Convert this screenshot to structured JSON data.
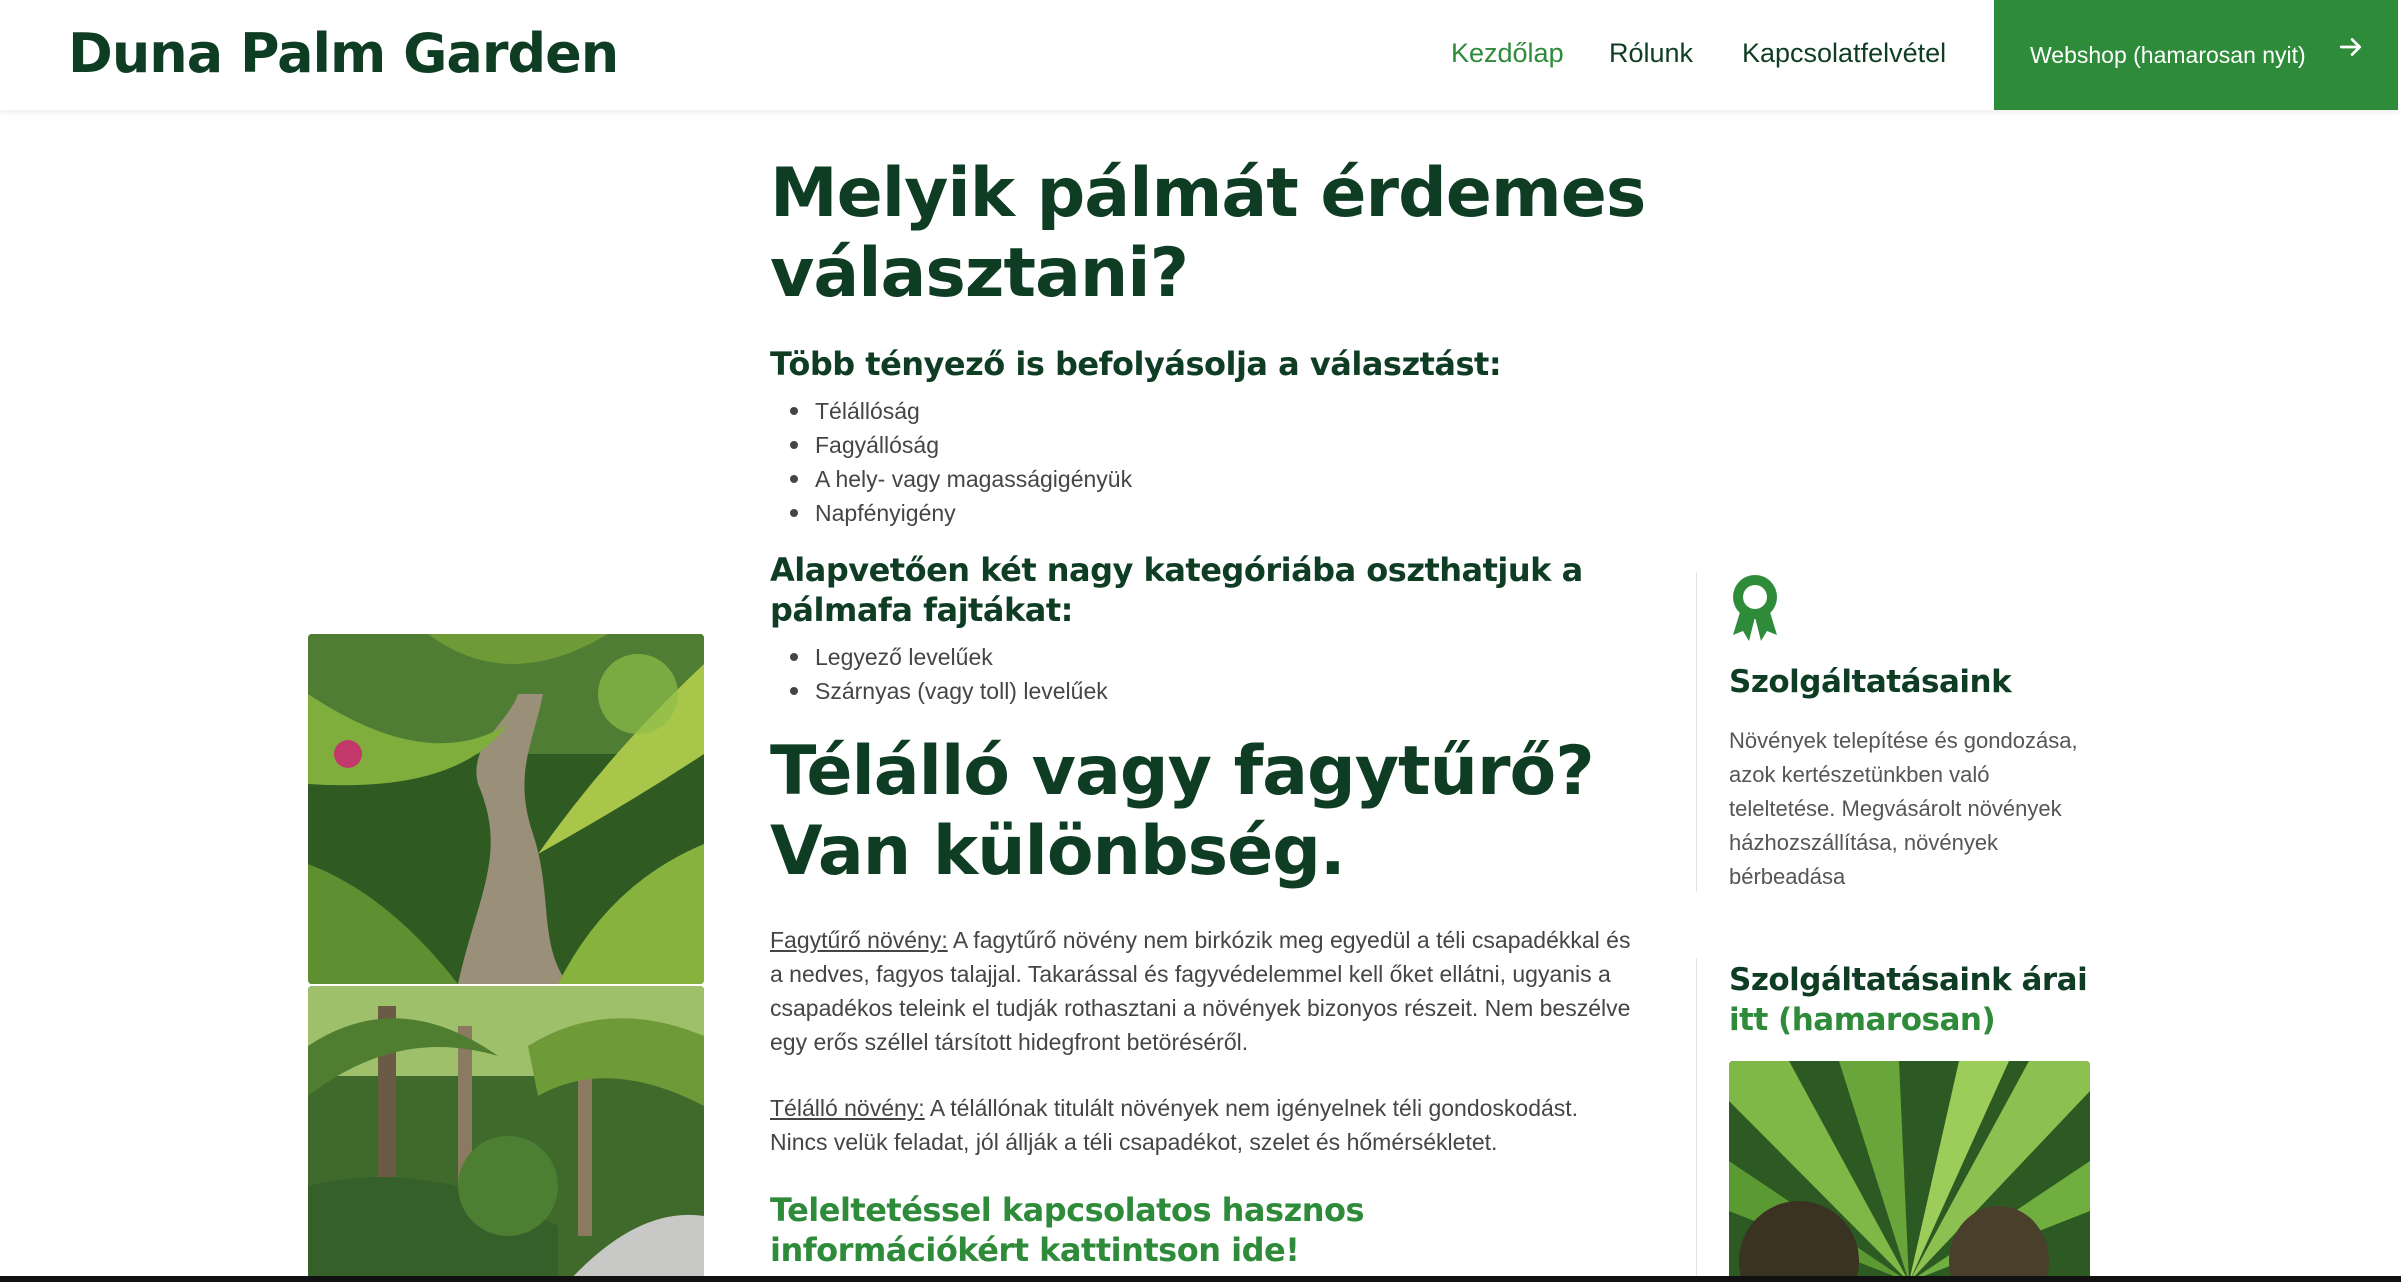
{
  "header": {
    "logo": "Duna Palm Garden",
    "nav": [
      {
        "label": "Kezdőlap",
        "active": true
      },
      {
        "label": "Rólunk",
        "active": false
      },
      {
        "label": "Kapcsolatfelvétel",
        "active": false
      }
    ],
    "shop_button": "Webshop (hamarosan nyit)",
    "shop_icon": "arrow-right-icon"
  },
  "main": {
    "title": "Melyik pálmát érdemes választani?",
    "factors_heading": "Több tényező is befolyásolja a választást:",
    "factors": [
      "Télállóság",
      "Fagyállóság",
      "A hely- vagy magasságigényük",
      "Napfényigény"
    ],
    "categories_heading": "Alapvetően két nagy kategóriába oszthatjuk a pálmafa fajtákat:",
    "categories": [
      "Legyező levelűek",
      "Szárnyas (vagy toll) levelűek"
    ],
    "section_title": "Télálló vagy fagytűrő? Van különbség.",
    "frost_term": "Fagytűrő növény:",
    "frost_text": " A fagytűrő növény nem birkózik meg egyedül a téli csapadékkal és a nedves, fagyos talajjal. Takarással és fagyvédelemmel kell őket ellátni, ugyanis a csapadékos teleink el tudják rothasztani a növények bizonyos részeit. Nem beszélve egy erős széllel társított hidegfront betöréséről.",
    "winter_term": "Télálló növény:",
    "winter_text": " A télállónak titulált növények nem igényelnek téli gondoskodást. Nincs velük feladat, jól állják a téli csapadékot, szelet és hőmérsékletet.",
    "info_link": "Teleltetéssel kapcsolatos hasznos információkért kattintson ide!"
  },
  "sidebar": {
    "services_icon": "award-ribbon-icon",
    "services_title": "Szolgáltatásaink",
    "services_text": "Növények telepítése és gondozása, azok kertészetünkben való teleltetése. Megvásárolt növények házhozszállítása, növények bérbeadása",
    "prices_title": "Szolgáltatásaink árai",
    "prices_link": "itt (hamarosan)"
  },
  "colors": {
    "brand_dark": "#0f3d24",
    "accent_green": "#2e8b3a"
  }
}
